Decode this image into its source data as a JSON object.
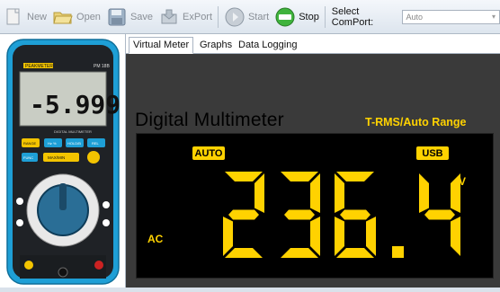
{
  "toolbar": {
    "new_label": "New",
    "open_label": "Open",
    "save_label": "Save",
    "export_label": "ExPort",
    "start_label": "Start",
    "stop_label": "Stop",
    "comport_label": "Select ComPort:",
    "comport_value": "Auto"
  },
  "tabs": [
    {
      "label": "Virtual Meter"
    },
    {
      "label": "Graphs"
    },
    {
      "label": "Data Logging"
    }
  ],
  "meter": {
    "title": "Digital Multimeter",
    "subtitle": "T-RMS/Auto Range",
    "auto_badge": "AUTO",
    "usb_badge": "USB",
    "mode": "AC",
    "unit": "V",
    "reading": "236.4",
    "device_brand": "PEAKMETER",
    "device_model": "PM 18B",
    "device_reading": "-5.999",
    "device_caption": "DIGITAL MULTIMETER",
    "device_buttons": [
      "RANGE",
      "Hz %",
      "HOLD/B",
      "REL",
      "MAX/MIN",
      "FUNC"
    ]
  },
  "colors": {
    "accent": "#ffd200",
    "lcd_bg": "#000000",
    "panel_bg": "#3a3a3a",
    "meter_body": "#1e9fd6"
  }
}
